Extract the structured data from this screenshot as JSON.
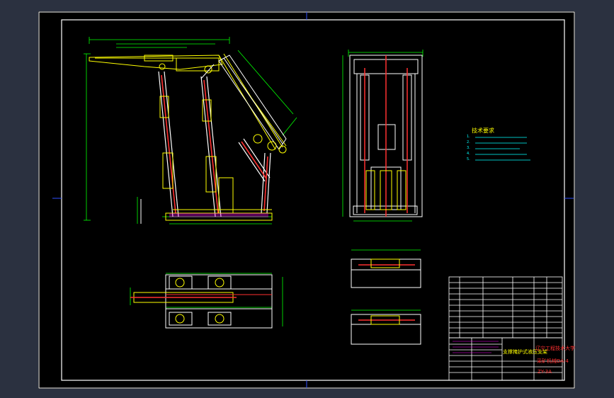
{
  "drawing": {
    "title_main": "支撑掩护式液压支架",
    "title_school": "辽宁工程技术大学",
    "title_course": "采矿机械DA-4",
    "drawing_number": "ZY-3A",
    "tech_requirements_title": "技术要求",
    "tech_requirements": [
      "1.",
      "2.",
      "3.",
      "4.",
      "5."
    ]
  },
  "colors": {
    "sheet_background": "#000000",
    "viewport_background": "#2b3140",
    "outline": "#ffffff",
    "geometry": "#ffff00",
    "dimensions": "#00ff00",
    "centerlines": "#ff3030",
    "hatch": "#ff00ff",
    "blue": "#3050ff",
    "cyan": "#00ffff"
  }
}
